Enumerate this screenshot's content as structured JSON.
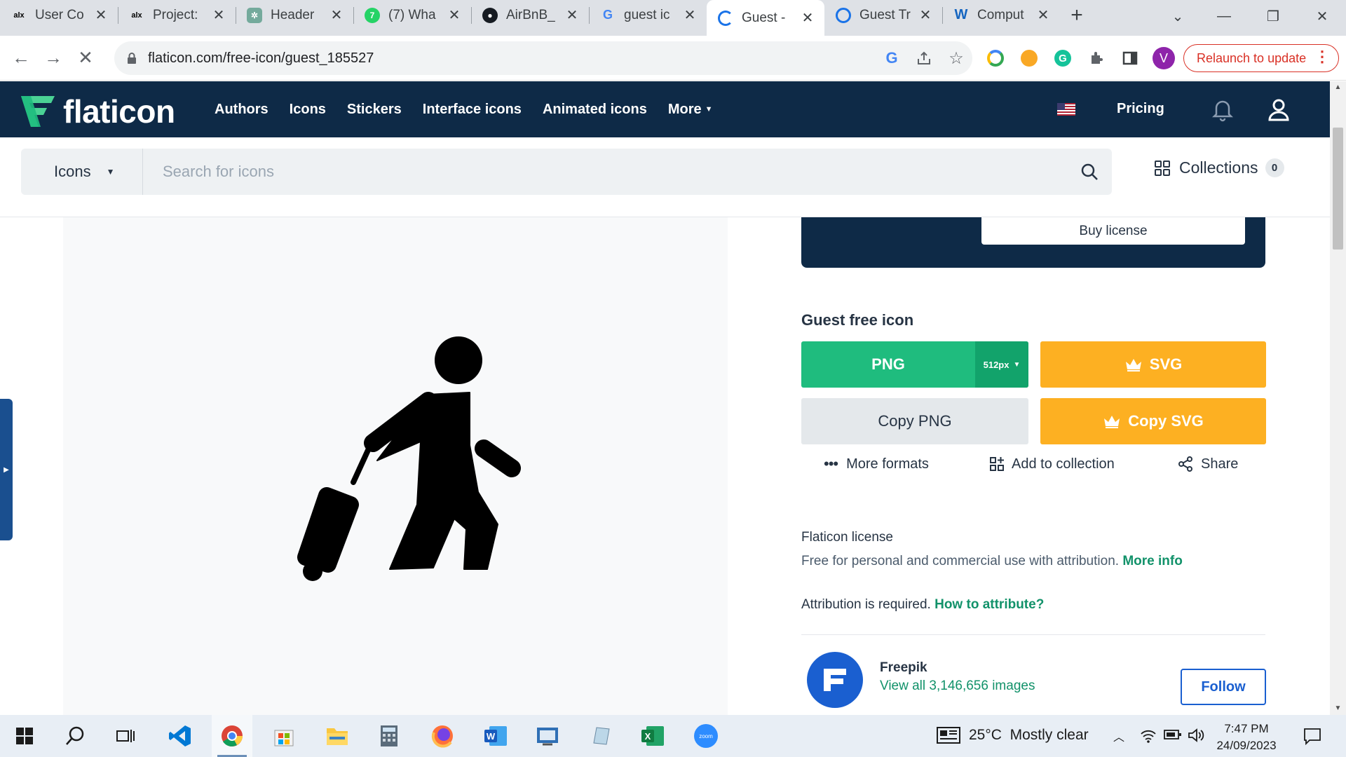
{
  "browser": {
    "tabs": [
      {
        "title": "User Co",
        "favicon": "alx"
      },
      {
        "title": "Project:",
        "favicon": "alx"
      },
      {
        "title": "Header",
        "favicon": "chatgpt-icon"
      },
      {
        "title": "(7) Wha",
        "favicon": "whatsapp-icon"
      },
      {
        "title": "AirBnB_",
        "favicon": "github-icon"
      },
      {
        "title": "guest ic",
        "favicon": "google-icon"
      },
      {
        "title": "Guest -",
        "favicon": "loading-icon",
        "active": true
      },
      {
        "title": "Guest Tr",
        "favicon": "chrome-icon"
      },
      {
        "title": "Comput",
        "favicon": "w-icon"
      }
    ],
    "url": "flaticon.com/free-icon/guest_185527",
    "profile_initial": "V",
    "relaunch_label": "Relaunch to update"
  },
  "site": {
    "logo_text": "flaticon",
    "nav": [
      "Authors",
      "Icons",
      "Stickers",
      "Interface icons",
      "Animated icons",
      "More"
    ],
    "pricing_label": "Pricing",
    "search": {
      "type_label": "Icons",
      "placeholder": "Search for icons"
    },
    "collections_label": "Collections",
    "collections_count": "0"
  },
  "panel": {
    "buy_license_label": "Buy license",
    "icon_title": "Guest free icon",
    "png_label": "PNG",
    "png_size": "512px",
    "svg_label": "SVG",
    "copy_png_label": "Copy PNG",
    "copy_svg_label": "Copy SVG",
    "more_formats_label": "More formats",
    "add_collection_label": "Add to collection",
    "share_label": "Share",
    "license_title": "Flaticon license",
    "license_text": "Free for personal and commercial use with attribution.",
    "license_link": "More info",
    "attribution_text": "Attribution is required.",
    "attribution_link": "How to attribute?",
    "author_name": "Freepik",
    "author_images": "View all 3,146,656 images",
    "follow_label": "Follow"
  },
  "taskbar": {
    "weather": "25°C  Mostly clear",
    "time": "7:47 PM",
    "date": "24/09/2023"
  },
  "colors": {
    "header_navy": "#0e2a47",
    "png_green": "#1fbc7e",
    "svg_orange": "#fdb022",
    "link_green": "#12926a",
    "follow_blue": "#1a5fd0"
  }
}
